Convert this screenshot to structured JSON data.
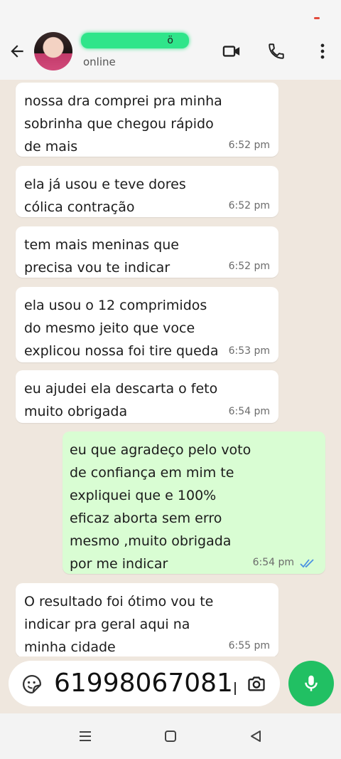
{
  "header": {
    "contact_name": "ӧ",
    "status": "online"
  },
  "messages": [
    {
      "dir": "in",
      "lines": [
        "nossa dra comprei pra minha",
        "sobrinha que chegou rápido",
        "de mais"
      ],
      "time": "6:52 pm"
    },
    {
      "dir": "in",
      "lines": [
        "ela já usou e teve dores",
        "cólica contração"
      ],
      "time": "6:52 pm"
    },
    {
      "dir": "in",
      "lines": [
        "tem mais meninas que",
        "precisa vou te indicar"
      ],
      "time": "6:52 pm"
    },
    {
      "dir": "in",
      "lines": [
        "ela usou o 12 comprimidos",
        "do mesmo jeito que voce",
        "explicou nossa foi tire queda"
      ],
      "time": "6:53 pm"
    },
    {
      "dir": "in",
      "lines": [
        "eu ajudei ela descarta o feto",
        "muito obrigada"
      ],
      "time": "6:54 pm"
    },
    {
      "dir": "out",
      "lines": [
        "eu que agradeço pelo voto",
        "de confiança em mim te",
        "expliquei que e 100%",
        "eficaz aborta sem erro",
        "mesmo ,muito obrigada",
        "por me indicar"
      ],
      "time": "6:54 pm",
      "read": true
    },
    {
      "dir": "in",
      "lines": [
        "O resultado foi ótimo vou te",
        "indicar pra geral aqui na",
        "minha cidade"
      ],
      "time": "6:55 pm"
    }
  ],
  "input": {
    "value": "61998067081"
  },
  "colors": {
    "accent": "#21c063",
    "outgoing_bubble": "#d9fdd3",
    "read_ticks": "#4a90e2",
    "name_highlight": "#2fe58a"
  },
  "icons": {
    "back": "arrow-left-icon",
    "video": "video-camera-icon",
    "call": "phone-icon",
    "menu": "more-vertical-icon",
    "sticker": "sticker-icon",
    "camera": "camera-icon",
    "mic": "microphone-icon"
  }
}
